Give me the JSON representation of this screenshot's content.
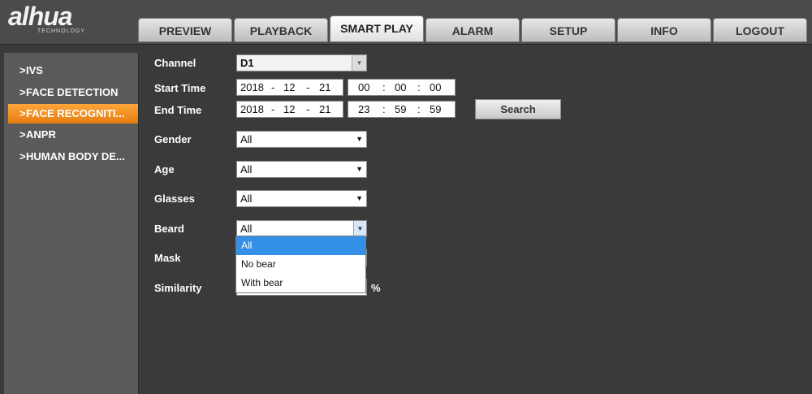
{
  "brand": {
    "logo": "alhua",
    "sub": "TECHNOLOGY"
  },
  "tabs": [
    {
      "label": "PREVIEW"
    },
    {
      "label": "PLAYBACK"
    },
    {
      "label": "SMART PLAY"
    },
    {
      "label": "ALARM"
    },
    {
      "label": "SETUP"
    },
    {
      "label": "INFO"
    },
    {
      "label": "LOGOUT"
    }
  ],
  "active_tab": "SMART PLAY",
  "sidebar": {
    "chevron": ">",
    "items": [
      {
        "label": "IVS"
      },
      {
        "label": "FACE DETECTION"
      },
      {
        "label": "FACE RECOGNITI..."
      },
      {
        "label": "ANPR"
      },
      {
        "label": "HUMAN BODY DE..."
      }
    ],
    "active_index": 2
  },
  "form": {
    "channel": {
      "label": "Channel",
      "value": "D1"
    },
    "start_time": {
      "label": "Start Time",
      "date": [
        "2018",
        "-",
        "12",
        "-",
        "21"
      ],
      "time": [
        "00",
        ":",
        "00",
        ":",
        "00"
      ]
    },
    "end_time": {
      "label": "End Time",
      "date": [
        "2018",
        "-",
        "12",
        "-",
        "21"
      ],
      "time": [
        "23",
        ":",
        "59",
        ":",
        "59"
      ]
    },
    "search_label": "Search",
    "gender": {
      "label": "Gender",
      "value": "All"
    },
    "age": {
      "label": "Age",
      "value": "All"
    },
    "glasses": {
      "label": "Glasses",
      "value": "All"
    },
    "beard": {
      "label": "Beard",
      "value": "All",
      "options": [
        "All",
        "No bear",
        "With bear"
      ],
      "highlighted": "All"
    },
    "mask": {
      "label": "Mask"
    },
    "similarity": {
      "label": "Similarity",
      "unit": "%"
    }
  },
  "icons": {
    "dropdown": "▼"
  },
  "colors": {
    "accent": "#f2911f",
    "highlight": "#3390e6"
  }
}
